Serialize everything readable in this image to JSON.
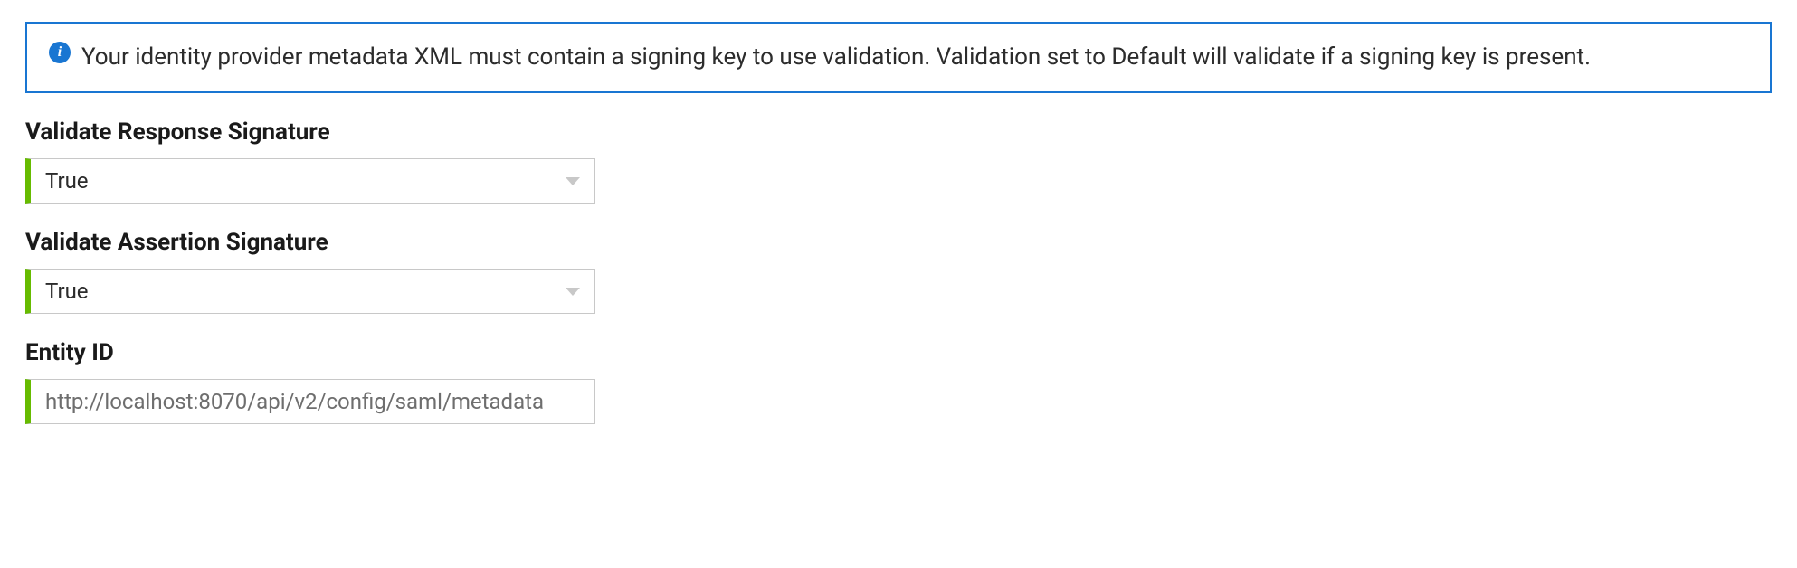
{
  "info": {
    "message": "Your identity provider metadata XML must contain a signing key to use validation. Validation set to Default will validate if a signing key is present."
  },
  "fields": {
    "validateResponseSignature": {
      "label": "Validate Response Signature",
      "value": "True"
    },
    "validateAssertionSignature": {
      "label": "Validate Assertion Signature",
      "value": "True"
    },
    "entityId": {
      "label": "Entity ID",
      "value": "http://localhost:8070/api/v2/config/saml/metadata"
    }
  }
}
